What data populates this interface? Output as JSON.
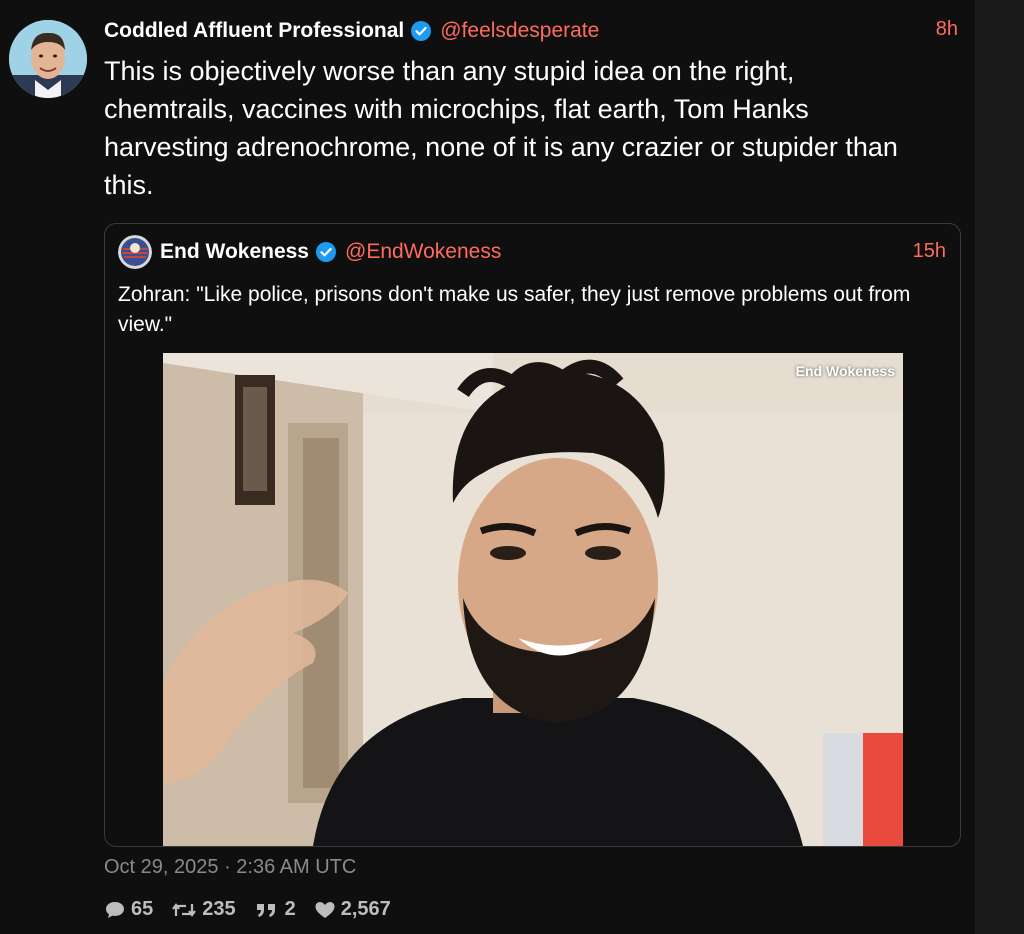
{
  "tweet": {
    "author_name": "Coddled Affluent Professional",
    "handle": "@feelsdesperate",
    "time": "8h",
    "text": "This is objectively worse than any stupid idea on the right, chemtrails, vaccines with microchips, flat earth, Tom Hanks harvesting adrenochrome, none of it is any crazier or stupider than this.",
    "date": "Oct 29, 2025 · 2:36 AM UTC"
  },
  "quote": {
    "author_name": "End Wokeness",
    "handle": "@EndWokeness",
    "time": "15h",
    "text": "Zohran: \"Like police, prisons don't make us safer, they just remove problems out from view.\"",
    "watermark": "End Wokeness"
  },
  "stats": {
    "replies": "65",
    "retweets": "235",
    "quotes": "2",
    "likes": "2,567"
  },
  "colors": {
    "background": "#0f0f0f",
    "link_accent": "#ff6b5e",
    "verified_badge": "#1d9bf0",
    "muted_text": "#8a8a8a"
  },
  "icons": [
    "verified-badge-icon",
    "reply-icon",
    "retweet-icon",
    "quote-icon",
    "like-icon"
  ]
}
